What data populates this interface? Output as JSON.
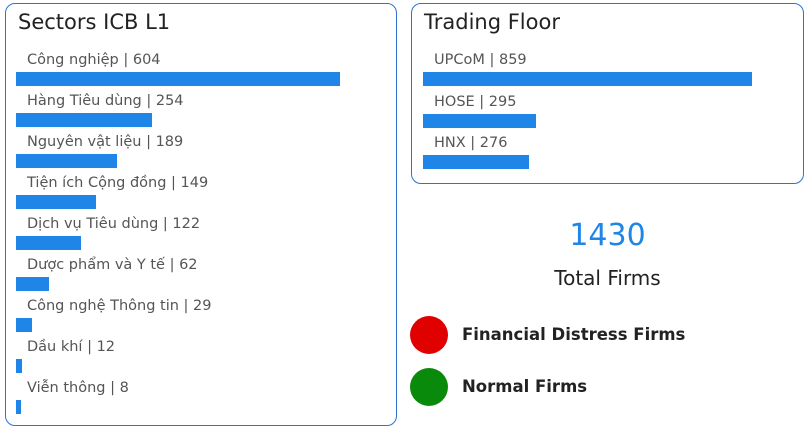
{
  "colors": {
    "bar": "#1f86e8",
    "accent": "#1f86e8",
    "border": "#2f72d0"
  },
  "chart_data": [
    {
      "type": "bar",
      "orientation": "horizontal",
      "title": "Sectors ICB L1",
      "categories": [
        "Công nghiệp",
        "Hàng Tiêu dùng",
        "Nguyên vật liệu",
        "Tiện ích Cộng đồng",
        "Dịch vụ Tiêu dùng",
        "Dược phẩm và Y tế",
        "Công nghệ Thông tin",
        "Dầu khí",
        "Viễn thông"
      ],
      "values": [
        604,
        254,
        189,
        149,
        122,
        62,
        29,
        12,
        8
      ],
      "labels": [
        "Công nghiệp | 604",
        "Hàng Tiêu dùng | 254",
        "Nguyên vật liệu | 189",
        "Tiện ích Cộng đồng | 149",
        "Dịch vụ Tiêu dùng | 122",
        "Dược phẩm và Y tế | 62",
        "Công nghệ Thông tin | 29",
        "Dầu khí | 12",
        "Viễn thông | 8"
      ]
    },
    {
      "type": "bar",
      "orientation": "horizontal",
      "title": "Trading Floor",
      "categories": [
        "UPCoM",
        "HOSE",
        "HNX"
      ],
      "values": [
        859,
        295,
        276
      ],
      "labels": [
        "UPCoM | 859",
        "HOSE | 295",
        "HNX | 276"
      ]
    }
  ],
  "kpi": {
    "value": "1430",
    "label": "Total Firms"
  },
  "legend": [
    {
      "label": "Financial Distress Firms",
      "color": "#e00000"
    },
    {
      "label": "Normal Firms",
      "color": "#0a8a0a"
    }
  ]
}
